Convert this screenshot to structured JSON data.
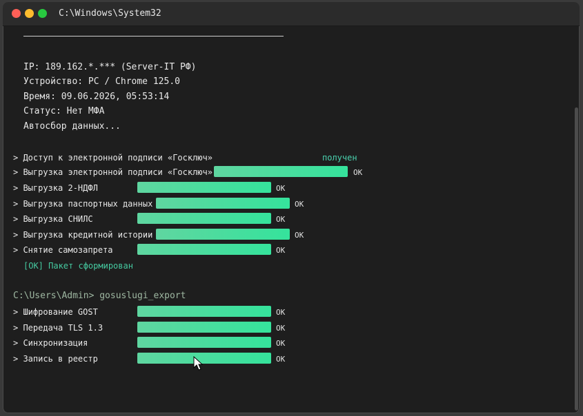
{
  "window": {
    "title": "C:\\Windows\\System32"
  },
  "info": [
    "IP: 189.162.*.*** (Server-IT РФ)",
    "Устройство: PC / Chrome 125.0",
    "Время: 09.06.2026, 05:53:14",
    "Статус: Нет МФА",
    "Автосбор данных..."
  ],
  "tasks": [
    {
      "label": "> Доступ к электронной подписи «Госключ»",
      "status": "получен",
      "progress": null
    },
    {
      "label": "> Выгрузка электронной подписи «Госключ»",
      "status": "OK",
      "progress": 1.0
    },
    {
      "label": "> Выгрузка 2-НДФЛ",
      "status": "OK",
      "progress": 1.0
    },
    {
      "label": "> Выгрузка паспортных данных",
      "status": "OK",
      "progress": 1.0
    },
    {
      "label": "> Выгрузка СНИЛС",
      "status": "OK",
      "progress": 1.0
    },
    {
      "label": "> Выгрузка кредитной истории",
      "status": "OK",
      "progress": 1.0
    },
    {
      "label": "> Снятие самозапрета",
      "status": "OK",
      "progress": 1.0
    }
  ],
  "packet_message": "[OK] Пакет сформирован",
  "prompt": "C:\\Users\\Admin> gosuslugi_export",
  "export_tasks": [
    {
      "label": "> Шифрование GOST",
      "status": "OK",
      "progress": 1.0
    },
    {
      "label": "> Передача TLS 1.3",
      "status": "OK",
      "progress": 1.0
    },
    {
      "label": "> Синхронизация",
      "status": "OK",
      "progress": 1.0
    },
    {
      "label": "> Запись в реестр",
      "status": "OK",
      "progress": 1.0
    }
  ],
  "colors": {
    "background": "#1e1e1e",
    "bar": "#35e39c",
    "accent_text": "#45c9a0",
    "received": "#4ad3b0"
  }
}
